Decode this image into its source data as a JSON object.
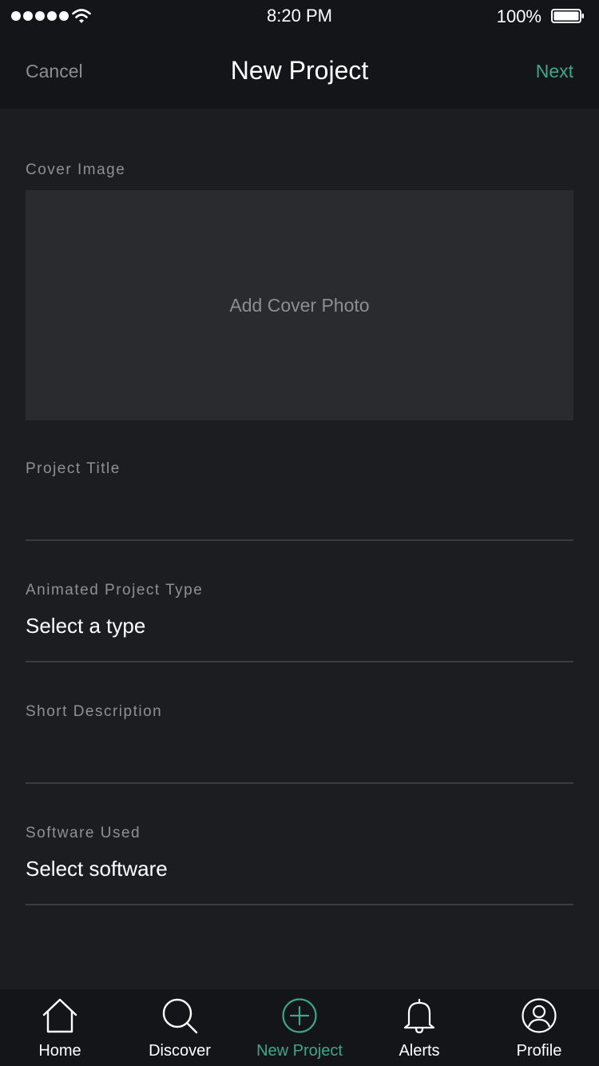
{
  "status_bar": {
    "time": "8:20 PM",
    "battery": "100%",
    "signal_icon": "signal-dots-icon",
    "wifi_icon": "wifi-icon",
    "battery_icon": "battery-icon"
  },
  "nav": {
    "cancel": "Cancel",
    "title": "New Project",
    "next": "Next"
  },
  "form": {
    "cover_image_label": "Cover Image",
    "cover_placeholder": "Add Cover Photo",
    "project_title_label": "Project Title",
    "project_title_value": "",
    "project_type_label": "Animated Project Type",
    "project_type_value": "Select a type",
    "short_description_label": "Short Description",
    "short_description_value": "",
    "software_label": "Software Used",
    "software_value": "Select software"
  },
  "tabs": [
    {
      "label": "Home",
      "icon": "home-icon",
      "active": false
    },
    {
      "label": "Discover",
      "icon": "search-icon",
      "active": false
    },
    {
      "label": "New Project",
      "icon": "plus-circle-icon",
      "active": true
    },
    {
      "label": "Alerts",
      "icon": "bell-icon",
      "active": false
    },
    {
      "label": "Profile",
      "icon": "profile-icon",
      "active": false
    }
  ],
  "colors": {
    "background": "#1c1d21",
    "bar_background": "#141518",
    "accent": "#3aa88a",
    "muted_text": "#8c8e93",
    "cover_box": "#2a2b2f"
  }
}
